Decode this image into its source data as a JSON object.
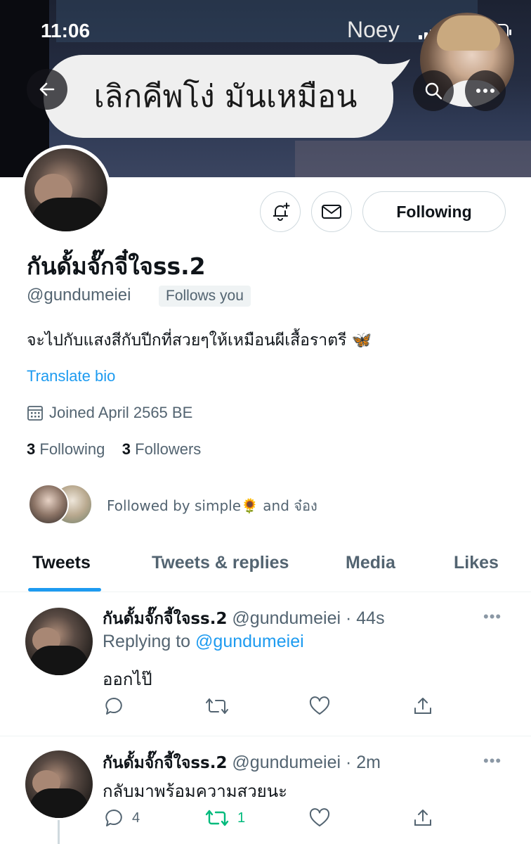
{
  "status_bar": {
    "time": "11:06",
    "carrier": "Noey"
  },
  "banner": {
    "speech_text": "เลิกคีพโง่ มันเหมือน"
  },
  "profile": {
    "display_name": "กันดั้มจั๊กจี๋ใจss.2",
    "handle": "@gundumeiei",
    "follows_you": "Follows you",
    "bio": "จะไปกับแสงสีกับปีกที่สวยๆให้เหมือนผีเสื้อราตรี 🦋",
    "translate_bio": "Translate bio",
    "joined": "Joined April 2565 BE",
    "following_count": "3",
    "following_label": "Following",
    "followers_count": "3",
    "followers_label": "Followers",
    "followed_by": "Followed by simple🌻 and จ๋อง",
    "following_button": "Following"
  },
  "tabs": [
    "Tweets",
    "Tweets & replies",
    "Media",
    "Likes"
  ],
  "active_tab": "Tweets",
  "tweets": [
    {
      "name": "กันดั้มจั๊กจี้ใจss.2",
      "handle": "@gundumeiei",
      "time": "· 44s",
      "replying_prefix": "Replying to",
      "replying_to": "@gundumeiei",
      "text": "ออกไป๊",
      "reply_count": "",
      "retweet_count": ""
    },
    {
      "name": "กันดั้มจั๊กจี้ใจss.2",
      "handle": "@gundumeiei",
      "time": "· 2m",
      "text": "กลับมาพร้อมความสวยนะ",
      "reply_count": "4",
      "retweet_count": "1"
    }
  ],
  "colors": {
    "accent": "#1d9bf0",
    "retweet_active": "#00ba7c",
    "secondary_text": "#536471"
  }
}
